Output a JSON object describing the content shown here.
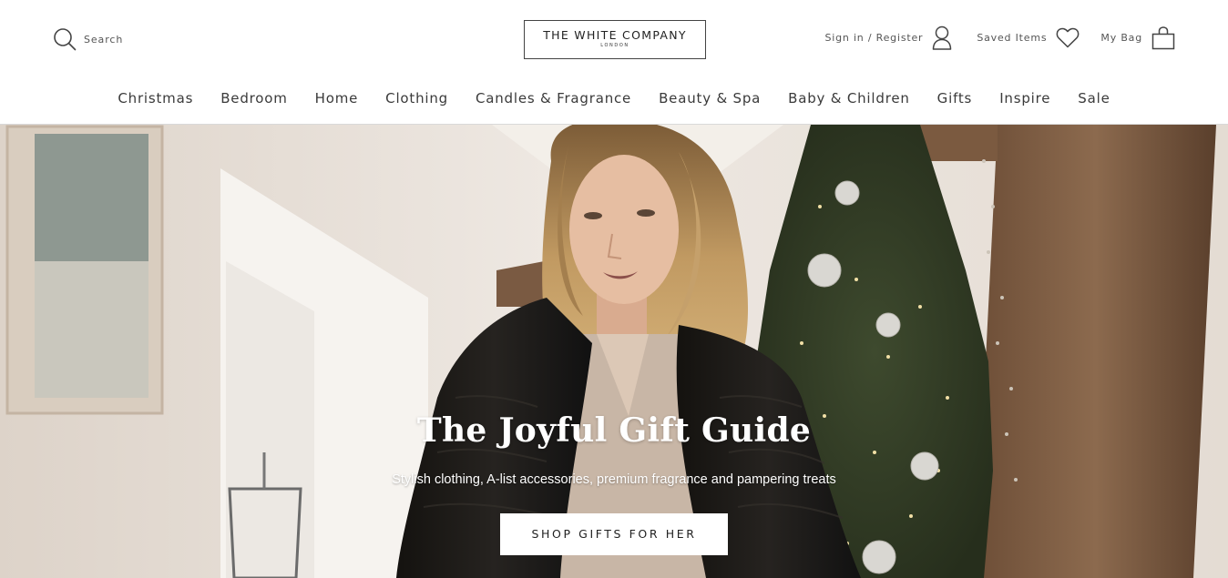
{
  "header": {
    "search_label": "Search",
    "logo": {
      "main": "THE WHITE COMPANY",
      "sub": "LONDON"
    },
    "utility": {
      "signin_label": "Sign in / Register",
      "saved_label": "Saved Items",
      "bag_label": "My Bag"
    }
  },
  "nav": {
    "items": [
      "Christmas",
      "Bedroom",
      "Home",
      "Clothing",
      "Candles & Fragrance",
      "Beauty & Spa",
      "Baby & Children",
      "Gifts",
      "Inspire",
      "Sale"
    ]
  },
  "hero": {
    "title": "The Joyful Gift Guide",
    "subtitle": "Stylish clothing, A-list accessories, premium fragrance and pampering treats",
    "cta_label": "SHOP GIFTS FOR HER"
  },
  "icons": {
    "search": "search-icon",
    "user": "user-icon",
    "heart": "heart-icon",
    "bag": "bag-icon"
  },
  "colors": {
    "text": "#333333",
    "nav_text": "#3a3a3a",
    "hero_text": "#ffffff",
    "button_bg": "#ffffff"
  }
}
